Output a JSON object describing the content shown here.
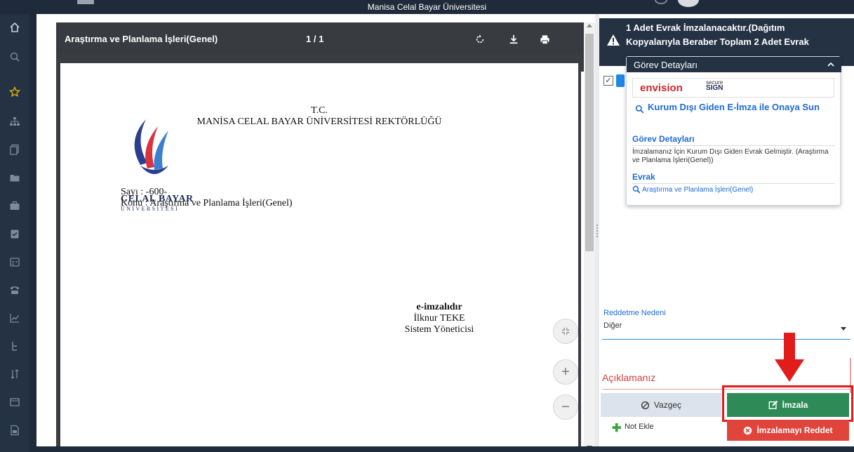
{
  "topbar": {
    "title": "Manisa Celal Bayar Üniversitesi"
  },
  "leftnav": {
    "items": [
      "home-icon",
      "search-icon",
      "star-icon",
      "sitemap-icon",
      "documents-icon",
      "folder-icon",
      "briefcase-icon",
      "clipboard-icon",
      "calendar-icon",
      "phone-icon",
      "chart-icon",
      "hierarchy-icon",
      "sort-icon",
      "window-icon",
      "file-icon"
    ]
  },
  "viewer": {
    "doc_title": "Araştırma ve Planlama İşleri(Genel)",
    "page_num": "1 / 1",
    "page": {
      "tc": "T.C.",
      "rektorluk": "MANİSA CELAL BAYAR ÜNİVERSİTESİ REKTÖRLÜĞÜ",
      "logo_name": "CELAL BAYAR",
      "logo_sub": "ÜNİVERSİTESİ",
      "sayi": "Sayı   : -600-",
      "konu": "Konu   : Araştırma ve Planlama İşleri(Genel)",
      "e_imza": "e-imzalıdır",
      "signer": "İlknur TEKE",
      "signer_title": "Sistem Yöneticisi"
    }
  },
  "right": {
    "warning": "1 Adet Evrak İmzalanacaktır.(Dağıtım Kopyalarıyla Beraber Toplam 2 Adet Evrak",
    "popup": {
      "header": "Görev Detayları",
      "brand": "envision",
      "secure_top": "secure",
      "secure_sign": "SIGN",
      "action_link": "Kurum Dışı Giden E-İmza ile Onaya Sun",
      "section1": "Görev Detayları",
      "section1_body": "İmzalamanız İçin Kurum Dışı Giden Evrak Gelmiştir. (Araştırma ve Planlama İşleri(Genel))",
      "section2": "Evrak",
      "evrak_link": "Araştırma ve Planlama İşleri(Genel)"
    },
    "reason_label": "Reddetme Nedeni",
    "reason_value": "Diğer",
    "aciklama_label": "Açıklamanız",
    "cancel_label": "Vazgeç",
    "sign_label": "İmzala",
    "note_label": "Not Ekle",
    "reject_label": "İmzalamayı Reddet",
    "accent_colors": {
      "sign": "#2e8b57",
      "reject": "#e0443b",
      "highlight": "#e21b1b",
      "link": "#1e6bd6"
    }
  }
}
